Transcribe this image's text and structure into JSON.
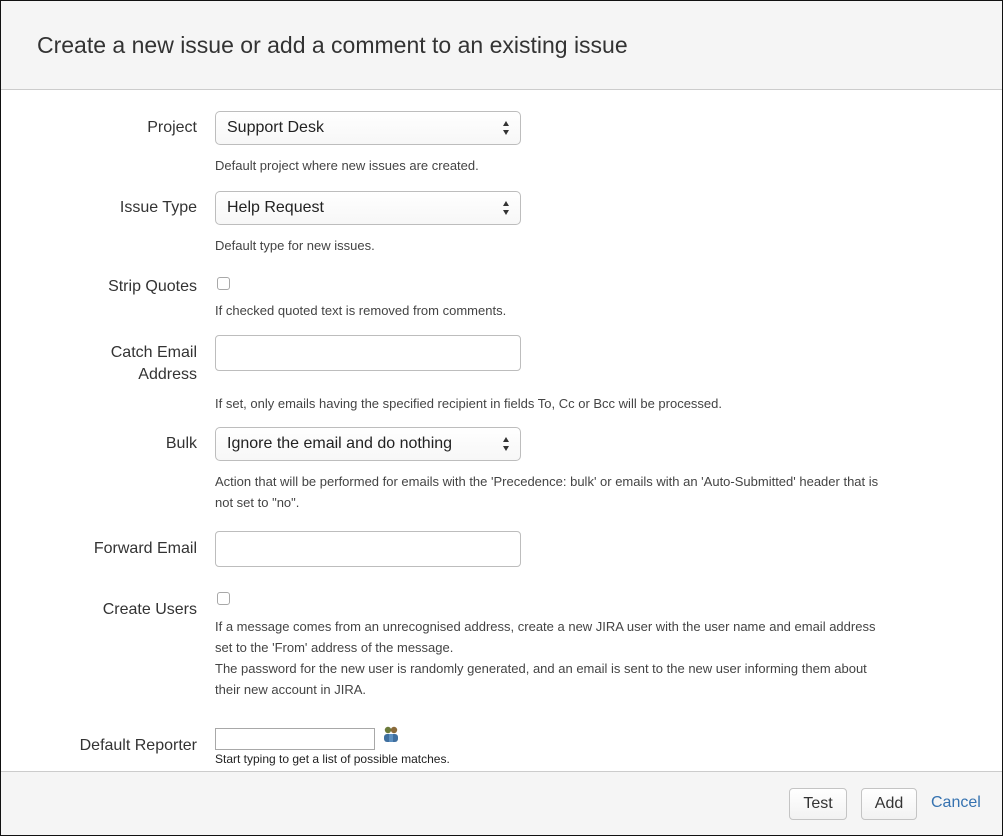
{
  "dialog": {
    "title": "Create a new issue or add a comment to an existing issue"
  },
  "form": {
    "project": {
      "label": "Project",
      "value": "Support Desk",
      "help": "Default project where new issues are created."
    },
    "issue_type": {
      "label": "Issue Type",
      "value": "Help Request",
      "help": "Default type for new issues."
    },
    "strip_quotes": {
      "label": "Strip Quotes",
      "checked": false,
      "help": "If checked quoted text is removed from comments."
    },
    "catch_email": {
      "label_line1": "Catch Email",
      "label_line2": "Address",
      "value": "",
      "help": "If set, only emails having the specified recipient in fields To, Cc or Bcc will be processed."
    },
    "bulk": {
      "label": "Bulk",
      "value": "Ignore the email and do nothing",
      "help_line1": "Action that will be performed for emails with the 'Precedence: bulk' or emails with an 'Auto-Submitted' header that is",
      "help_line2": "not set to \"no\"."
    },
    "forward_email": {
      "label": "Forward Email",
      "value": ""
    },
    "create_users": {
      "label": "Create Users",
      "checked": false,
      "help_line1": "If a message comes from an unrecognised address, create a new JIRA user with the user name and email address",
      "help_line2": "set to the 'From' address of the message.",
      "help_line3": "The password for the new user is randomly generated, and an email is sent to the new user informing them about",
      "help_line4": "their new account in JIRA."
    },
    "default_reporter": {
      "label": "Default Reporter",
      "value": "",
      "help": "Start typing to get a list of possible matches.",
      "icon": "user-picker-icon"
    }
  },
  "footer": {
    "test_label": "Test",
    "add_label": "Add",
    "cancel_label": "Cancel"
  },
  "colors": {
    "header_bg": "#f5f5f5",
    "link": "#3572b0",
    "border": "#cccccc"
  }
}
